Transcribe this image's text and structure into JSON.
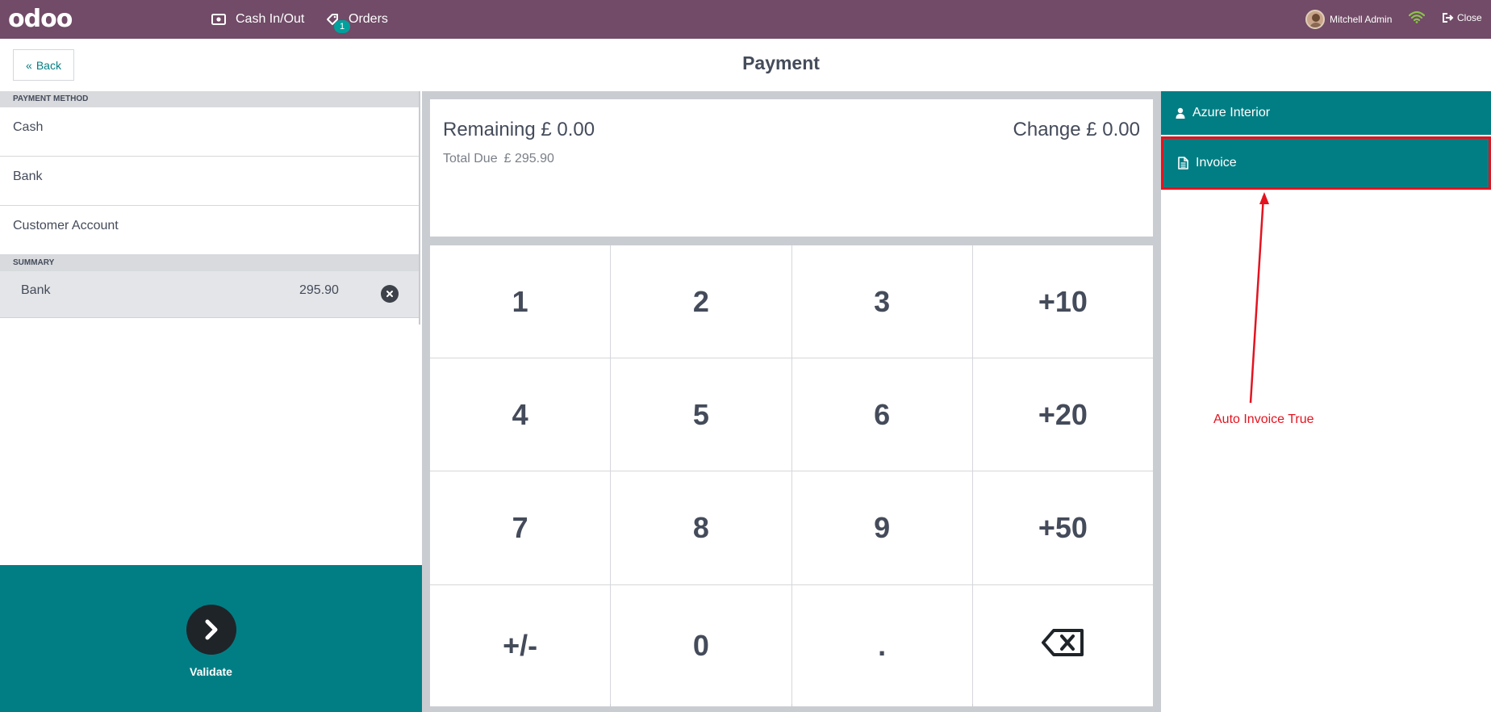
{
  "navbar": {
    "logo": "odoo",
    "cash_in_out": "Cash In/Out",
    "orders": "Orders",
    "orders_badge": "1",
    "user_name": "Mitchell Admin",
    "close": "Close"
  },
  "header": {
    "back": "Back",
    "title": "Payment"
  },
  "payment_methods": {
    "heading": "PAYMENT METHOD",
    "items": [
      {
        "label": "Cash"
      },
      {
        "label": "Bank"
      },
      {
        "label": "Customer Account"
      }
    ]
  },
  "summary": {
    "heading": "SUMMARY",
    "lines": [
      {
        "name": "Bank",
        "amount": "295.90"
      }
    ]
  },
  "validate": {
    "label": "Validate"
  },
  "status": {
    "remaining": "Remaining £ 0.00",
    "change": "Change £ 0.00",
    "total_due_label": "Total Due",
    "total_due_value": "£ 295.90"
  },
  "numpad": {
    "keys": [
      "1",
      "2",
      "3",
      "+10",
      "4",
      "5",
      "6",
      "+20",
      "7",
      "8",
      "9",
      "+50",
      "+/-",
      "0",
      ".",
      "backspace"
    ]
  },
  "right_panel": {
    "customer": "Azure Interior",
    "invoice": "Invoice",
    "annotation": "Auto Invoice True"
  },
  "colors": {
    "navbar": "#714b67",
    "primary": "#017e84",
    "annotation": "#e3131f"
  }
}
